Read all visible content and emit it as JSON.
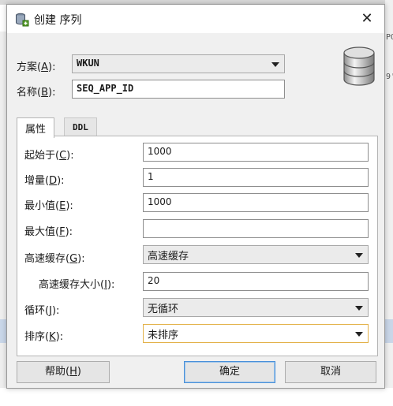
{
  "dialog": {
    "title": "创建 序列",
    "close_glyph": "✕"
  },
  "form": {
    "schema": {
      "label": "方案",
      "mnemonic": "A",
      "value": "WKUN"
    },
    "name": {
      "label": "名称",
      "mnemonic": "B",
      "value": "SEQ_APP_ID"
    }
  },
  "tabs": [
    {
      "label": "属性",
      "active": true
    },
    {
      "label": "DDL",
      "active": false
    }
  ],
  "properties": {
    "start_with": {
      "label": "起始于",
      "mnemonic": "C",
      "value": "1000"
    },
    "increment": {
      "label": "增量",
      "mnemonic": "D",
      "value": "1"
    },
    "min_value": {
      "label": "最小值",
      "mnemonic": "E",
      "value": "1000"
    },
    "max_value": {
      "label": "最大值",
      "mnemonic": "F",
      "value": ""
    },
    "cache": {
      "label": "高速缓存",
      "mnemonic": "G",
      "value": "高速缓存"
    },
    "cache_size": {
      "label": "高速缓存大小",
      "mnemonic": "I",
      "value": "20"
    },
    "cycle": {
      "label": "循环",
      "mnemonic": "J",
      "value": "无循环"
    },
    "order": {
      "label": "排序",
      "mnemonic": "K",
      "value": "未排序"
    }
  },
  "buttons": {
    "help": {
      "label": "帮助",
      "mnemonic": "H"
    },
    "ok": {
      "label": "确定"
    },
    "cancel": {
      "label": "取消"
    }
  },
  "background_fragments": [
    "PO",
    "9'"
  ],
  "colors": {
    "dialog_bg": "#f0f0f0",
    "focus_border": "#e3b24a",
    "primary_border": "#4a90d9"
  },
  "icons": {
    "title": "database-sequence-icon",
    "banner": "database-cylinder-icon",
    "close": "close-icon",
    "dropdown": "chevron-down-icon"
  }
}
